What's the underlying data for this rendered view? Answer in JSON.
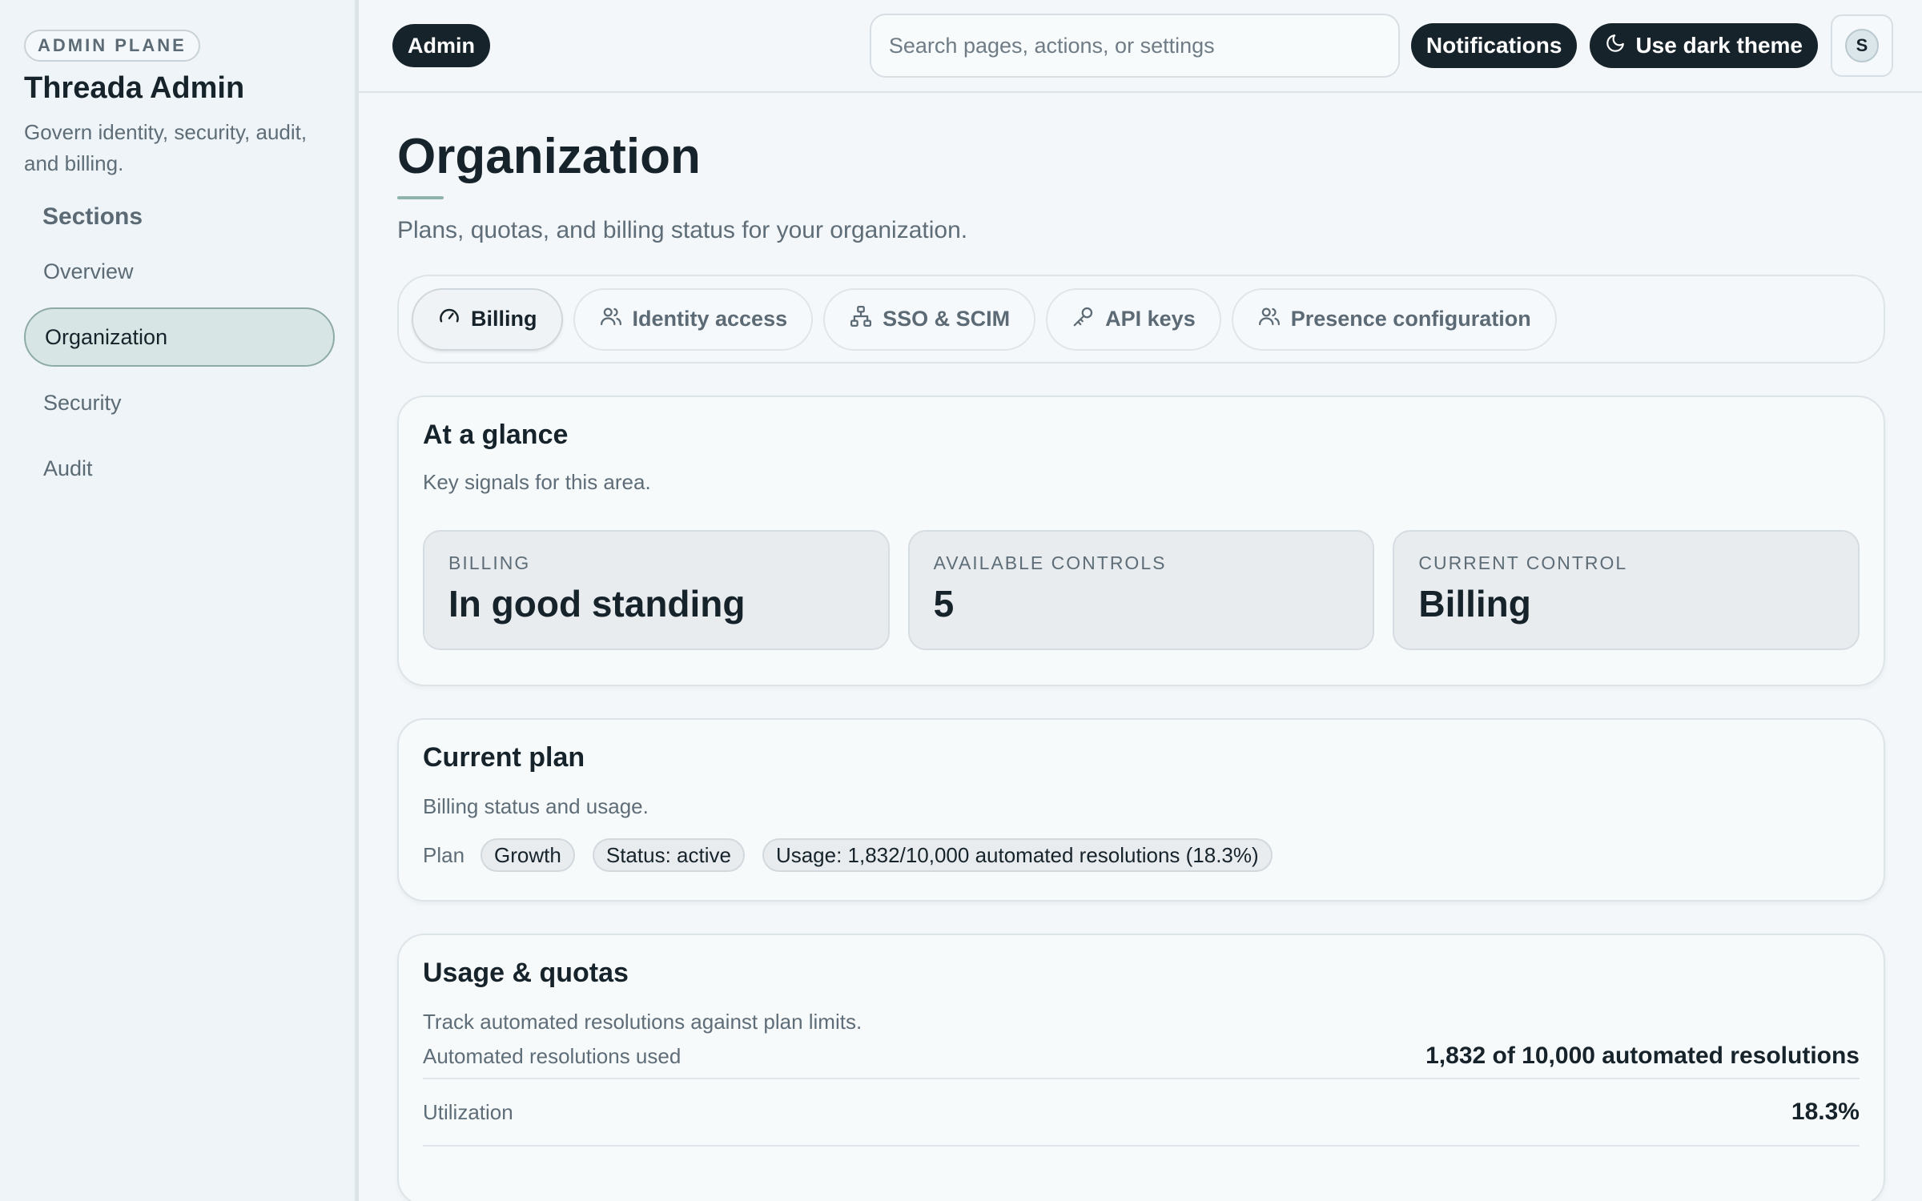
{
  "sidebar": {
    "badge": "ADMIN PLANE",
    "title": "Threada Admin",
    "description": "Govern identity, security, audit, and billing.",
    "sections_label": "Sections",
    "items": [
      {
        "label": "Overview",
        "active": false
      },
      {
        "label": "Organization",
        "active": true
      },
      {
        "label": "Security",
        "active": false
      },
      {
        "label": "Audit",
        "active": false
      }
    ]
  },
  "topbar": {
    "role": "Admin",
    "search_placeholder": "Search pages, actions, or settings",
    "notifications_label": "Notifications",
    "theme_label": "Use dark theme",
    "avatar_initial": "S"
  },
  "page": {
    "title": "Organization",
    "subtitle": "Plans, quotas, and billing status for your organization."
  },
  "tabs": [
    {
      "label": "Billing",
      "icon": "gauge-icon",
      "active": true
    },
    {
      "label": "Identity access",
      "icon": "users-icon",
      "active": false
    },
    {
      "label": "SSO & SCIM",
      "icon": "network-icon",
      "active": false
    },
    {
      "label": "API keys",
      "icon": "key-icon",
      "active": false
    },
    {
      "label": "Presence configuration",
      "icon": "users-icon",
      "active": false
    }
  ],
  "glance": {
    "title": "At a glance",
    "description": "Key signals for this area.",
    "stats": [
      {
        "label": "BILLING",
        "value": "In good standing"
      },
      {
        "label": "AVAILABLE CONTROLS",
        "value": "5"
      },
      {
        "label": "CURRENT CONTROL",
        "value": "Billing"
      }
    ]
  },
  "plan": {
    "title": "Current plan",
    "description": "Billing status and usage.",
    "plan_label": "Plan",
    "chips": [
      "Growth",
      "Status: active",
      "Usage: 1,832/10,000 automated resolutions (18.3%)"
    ]
  },
  "usage": {
    "title": "Usage & quotas",
    "description": "Track automated resolutions against plan limits.",
    "rows": [
      {
        "label": "Automated resolutions used",
        "value": "1,832 of 10,000 automated resolutions"
      },
      {
        "label": "Utilization",
        "value": "18.3%"
      }
    ]
  },
  "colors": {
    "accent_dark": "#17232b",
    "active_nav_bg": "#d7e6e4",
    "background": "#f3f7f9"
  }
}
